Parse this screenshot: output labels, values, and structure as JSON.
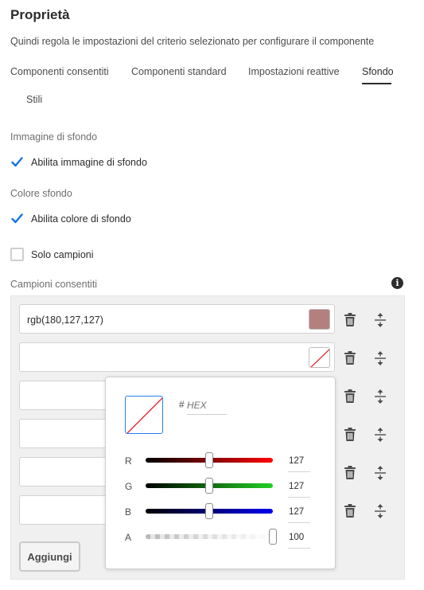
{
  "header": {
    "title": "Proprietà",
    "description": "Quindi regola le impostazioni del criterio selezionato per configurare il componente"
  },
  "tabs": [
    {
      "label": "Componenti consentiti",
      "active": false
    },
    {
      "label": "Componenti standard",
      "active": false
    },
    {
      "label": "Impostazioni reattive",
      "active": false
    },
    {
      "label": "Sfondo",
      "active": true
    },
    {
      "label": "Stili",
      "active": false
    }
  ],
  "background_image": {
    "section_label": "Immagine di sfondo",
    "enable_label": "Abilita immagine di sfondo",
    "enabled": true
  },
  "background_color": {
    "section_label": "Colore sfondo",
    "enable_label": "Abilita colore di sfondo",
    "enabled": true,
    "swatches_only_label": "Solo campioni",
    "swatches_only": false
  },
  "swatches": {
    "label": "Campioni consentiti",
    "items": [
      {
        "value": "rgb(180,127,127)",
        "color": "#b47f7f"
      },
      {
        "value": "",
        "color": null
      },
      {
        "value": "",
        "color": null
      },
      {
        "value": "",
        "color": null
      },
      {
        "value": "",
        "color": null
      },
      {
        "value": "",
        "color": null
      }
    ],
    "add_label": "Aggiungi"
  },
  "color_picker": {
    "hash": "#",
    "hex_placeholder": "HEX",
    "sliders": [
      {
        "label": "R",
        "value": "127",
        "fraction": 0.5,
        "gradient": [
          "#000000",
          "#ff0000"
        ]
      },
      {
        "label": "G",
        "value": "127",
        "fraction": 0.5,
        "gradient": [
          "#000000",
          "#22d022"
        ]
      },
      {
        "label": "B",
        "value": "127",
        "fraction": 0.5,
        "gradient": [
          "#000000",
          "#0000ee"
        ]
      },
      {
        "label": "A",
        "value": "100",
        "fraction": 1.0,
        "gradient": [
          "checker",
          "#ffffff"
        ]
      }
    ]
  },
  "colors": {
    "accent_blue": "#2680eb",
    "checkbox_blue": "#1473e6",
    "text_dark": "#2c2c2c"
  },
  "icons": {
    "delete": "trash-icon",
    "reorder": "drag-handle-icon",
    "info": "info-icon",
    "check": "checkmark-icon"
  }
}
